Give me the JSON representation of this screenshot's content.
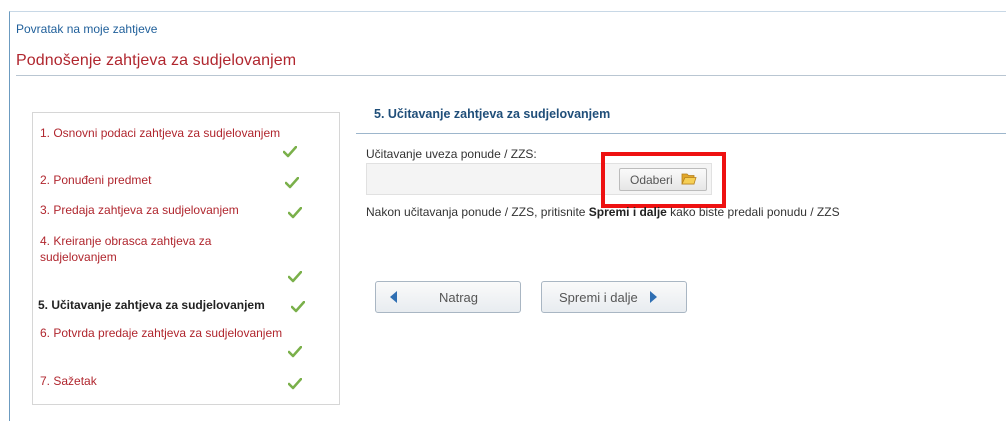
{
  "back_link": "Povratak na moje zahtjeve",
  "page_title": "Podnošenje zahtjeva za sudjelovanjem",
  "steps": [
    {
      "label": "1. Osnovni podaci zahtjeva za sudjelovanjem",
      "completed": true
    },
    {
      "label": "2. Ponuđeni predmet",
      "completed": true
    },
    {
      "label": "3. Predaja zahtjeva za sudjelovanjem",
      "completed": true
    },
    {
      "label": "4. Kreiranje obrasca zahtjeva za",
      "label_line2": "sudjelovanjem",
      "completed": true
    },
    {
      "label": "5. Učitavanje zahtjeva za sudjelovanjem",
      "completed": true,
      "active": true
    },
    {
      "label": "6. Potvrda predaje zahtjeva za sudjelovanjem",
      "completed": true
    },
    {
      "label": "7. Sažetak",
      "completed": true
    }
  ],
  "section_title": "5. Učitavanje zahtjeva za sudjelovanjem",
  "upload": {
    "label": "Učitavanje uveza ponude / ZZS:",
    "value": "",
    "button_label": "Odaberi"
  },
  "hint": {
    "before": "Nakon učitavanja ponude / ZZS, pritisnite ",
    "bold": "Spremi i dalje",
    "after": " kako biste predali ponudu / ZZS"
  },
  "buttons": {
    "back": "Natrag",
    "next": "Spremi i dalje"
  },
  "icons": {
    "check": "checkmark-icon",
    "folder": "folder-icon",
    "prev": "triangle-left-icon",
    "next": "triangle-right-icon"
  },
  "colors": {
    "title": "#b0262e",
    "link": "#1f5f9a",
    "section": "#1f4e79",
    "check": "#7ab04a",
    "highlight": "#ee1111",
    "arrow": "#2f6fb3"
  }
}
